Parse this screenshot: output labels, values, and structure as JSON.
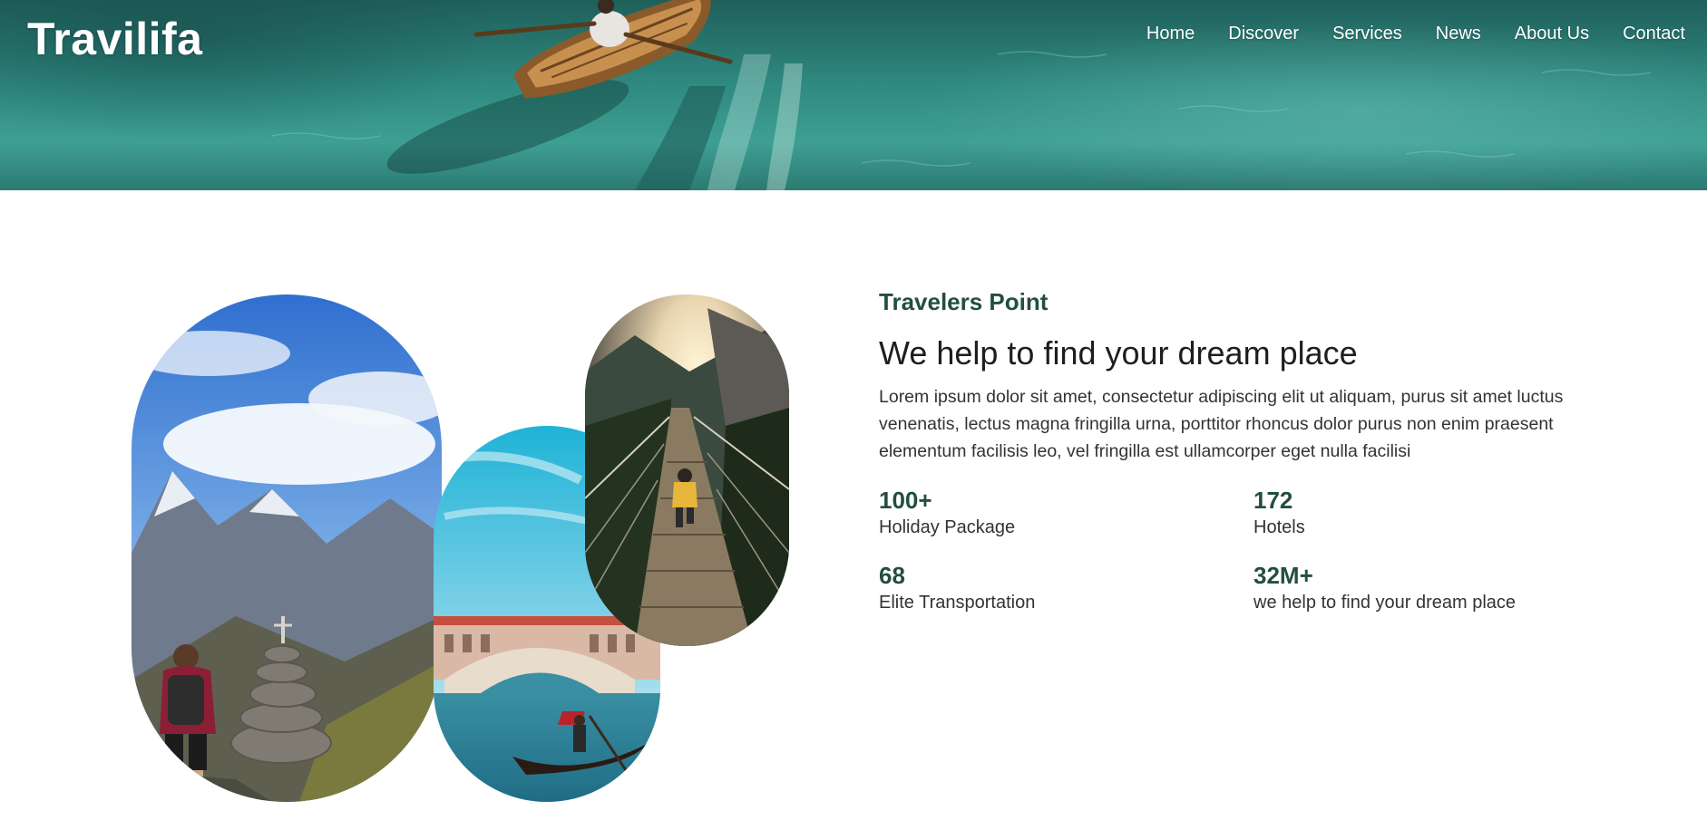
{
  "header": {
    "brand": "Travilifa",
    "nav": [
      "Home",
      "Discover",
      "Services",
      "News",
      "About Us",
      "Contact"
    ]
  },
  "about": {
    "eyebrow": "Travelers Point",
    "headline": "We help to find your dream place",
    "description": "Lorem ipsum dolor sit amet, consectetur adipiscing elit ut aliquam, purus sit amet luctus venenatis, lectus magna fringilla urna, porttitor rhoncus dolor purus non enim praesent elementum facilisis leo, vel fringilla est ullamcorper eget nulla facilisi",
    "stats": [
      {
        "value": "100+",
        "label": "Holiday Package"
      },
      {
        "value": "172",
        "label": "Hotels"
      },
      {
        "value": "68",
        "label": "Elite Transportation"
      },
      {
        "value": "32M+",
        "label": "we help to find your dream place"
      }
    ]
  },
  "images": {
    "hero": "rowing-boat-on-turquoise-lake",
    "collage": [
      "hiker-mountain-cairn",
      "venice-gondola-rialto-bridge",
      "suspension-bridge-forest-sunrise"
    ]
  },
  "colors": {
    "accent": "#234f3d",
    "text": "#222222",
    "background": "#ffffff",
    "hero_water": "#2f8a80"
  }
}
